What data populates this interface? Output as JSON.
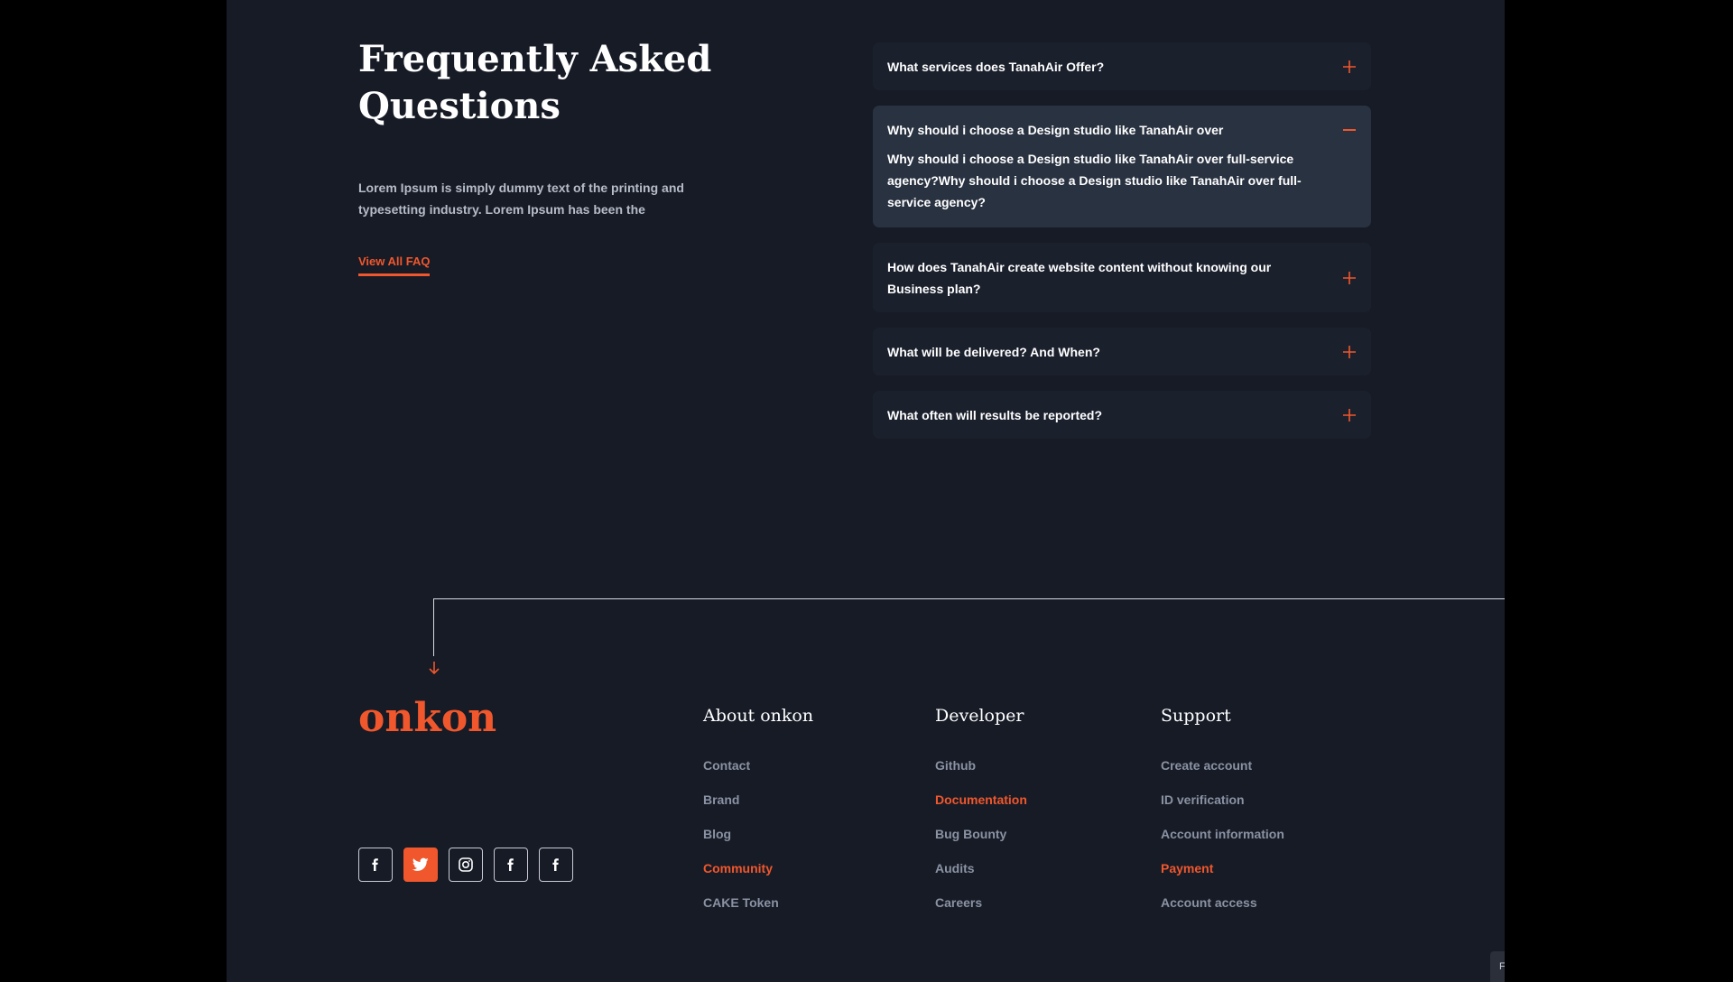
{
  "faq": {
    "title": "Frequently Asked Questions",
    "description": "Lorem Ipsum is simply dummy text of the printing and typesetting industry. Lorem Ipsum has been the",
    "view_all_label": "View All FAQ",
    "items": [
      {
        "question": "What services does TanahAir Offer?",
        "answer": "",
        "open": false
      },
      {
        "question": "Why should i choose a Design studio like TanahAir over",
        "answer": "Why should i choose a Design studio like TanahAir over full-service agency?Why should i choose a Design studio like TanahAir over full-service agency?",
        "open": true
      },
      {
        "question": "How does TanahAir create website content without knowing our Business plan?",
        "answer": "",
        "open": false
      },
      {
        "question": "What will be delivered? And When?",
        "answer": "",
        "open": false
      },
      {
        "question": "What often will results be reported?",
        "answer": "",
        "open": false
      }
    ]
  },
  "footer": {
    "logo": "onkon",
    "socials": [
      {
        "icon": "facebook-icon",
        "active": false
      },
      {
        "icon": "twitter-icon",
        "active": true
      },
      {
        "icon": "instagram-icon",
        "active": false
      },
      {
        "icon": "facebook-icon",
        "active": false
      },
      {
        "icon": "facebook-icon",
        "active": false
      }
    ],
    "columns": [
      {
        "title": "About onkon",
        "links": [
          {
            "label": "Contact",
            "highlight": false
          },
          {
            "label": "Brand",
            "highlight": false
          },
          {
            "label": "Blog",
            "highlight": false
          },
          {
            "label": "Community",
            "highlight": true
          },
          {
            "label": "CAKE Token",
            "highlight": false
          }
        ]
      },
      {
        "title": "Developer",
        "links": [
          {
            "label": "Github",
            "highlight": false
          },
          {
            "label": "Documentation",
            "highlight": true
          },
          {
            "label": "Bug Bounty",
            "highlight": false
          },
          {
            "label": "Audits",
            "highlight": false
          },
          {
            "label": "Careers",
            "highlight": false
          }
        ]
      },
      {
        "title": "Support",
        "links": [
          {
            "label": "Create account",
            "highlight": false
          },
          {
            "label": "ID verification",
            "highlight": false
          },
          {
            "label": "Account information",
            "highlight": false
          },
          {
            "label": "Payment",
            "highlight": true
          },
          {
            "label": "Account access",
            "highlight": false
          }
        ]
      }
    ]
  },
  "corner_tab_label": "F",
  "colors": {
    "background": "#171b26",
    "outer": "#000000",
    "accent": "#f0572d",
    "card": "#1b202d",
    "card_open": "#293241",
    "muted_link": "#8a92a3"
  }
}
